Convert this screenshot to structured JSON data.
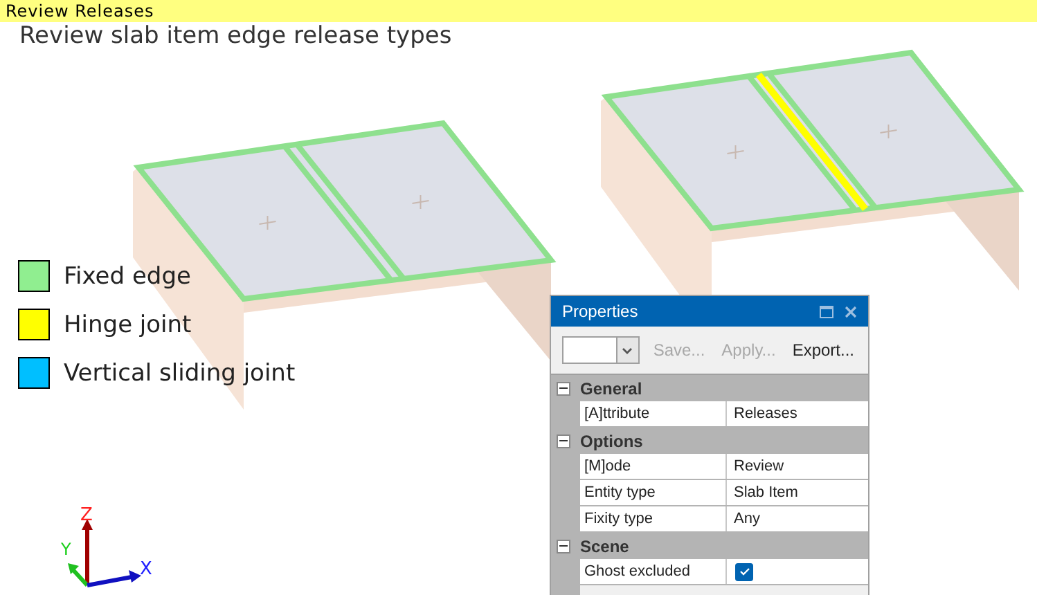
{
  "banner": {
    "title": "Review Releases"
  },
  "heading": "Review slab item edge release types",
  "slabs": [
    {
      "hinged": false
    },
    {
      "hinged": true
    }
  ],
  "legend": [
    {
      "label": "Fixed edge",
      "color": "#90ee90"
    },
    {
      "label": "Hinge joint",
      "color": "#ffff00"
    },
    {
      "label": "Vertical sliding joint",
      "color": "#00bfff"
    }
  ],
  "axes": {
    "z": "Z",
    "y": "Y",
    "x": "X"
  },
  "properties": {
    "title": "Properties",
    "toolbar": [
      {
        "label": "Save...",
        "disabled": true
      },
      {
        "label": "Apply...",
        "disabled": true
      },
      {
        "label": "Export...",
        "disabled": false
      }
    ],
    "groups": [
      {
        "name": "General",
        "expanded": true,
        "rows": [
          {
            "kind": "text",
            "name": "[A]ttribute",
            "value": "Releases"
          }
        ]
      },
      {
        "name": "Options",
        "expanded": true,
        "rows": [
          {
            "kind": "text",
            "name": "[M]ode",
            "value": "Review"
          },
          {
            "kind": "text",
            "name": "Entity type",
            "value": "Slab Item"
          },
          {
            "kind": "text",
            "name": "Fixity type",
            "value": "Any"
          }
        ]
      },
      {
        "name": "Scene",
        "expanded": true,
        "rows": [
          {
            "kind": "checkbox",
            "name": "Ghost excluded",
            "checked": true
          }
        ]
      }
    ]
  }
}
